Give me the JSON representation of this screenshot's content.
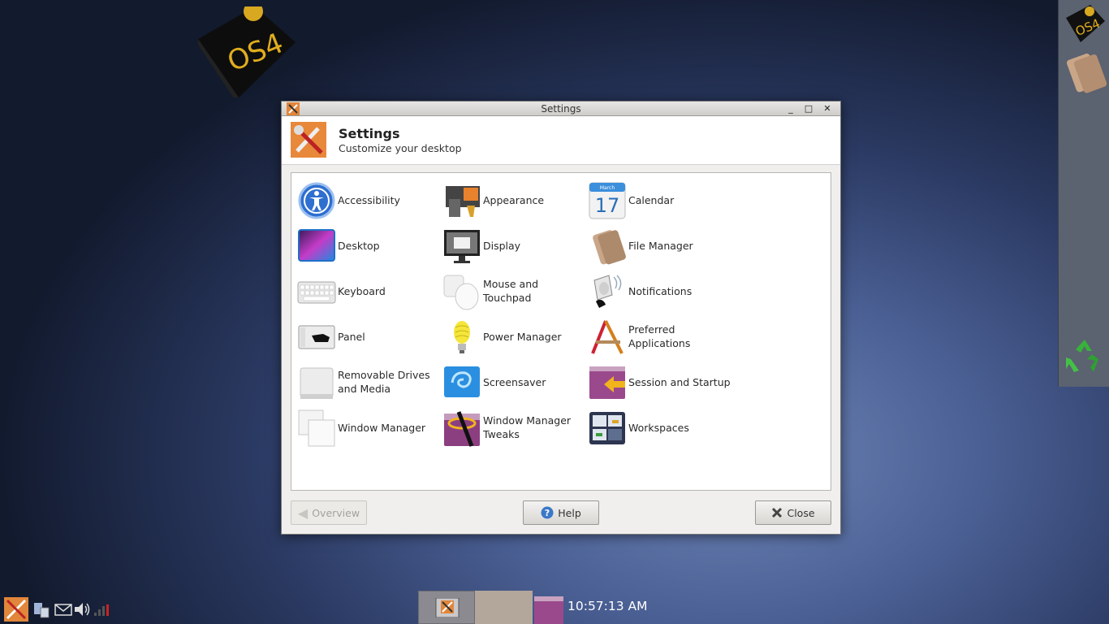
{
  "desktop": {
    "logo_text": "OS4"
  },
  "window": {
    "title": "Settings",
    "titlebar_buttons": {
      "minimize": "_",
      "maximize": "□",
      "close": "✕"
    },
    "header": {
      "title": "Settings",
      "subtitle": "Customize your desktop"
    },
    "items": [
      {
        "label": "Accessibility",
        "icon": "accessibility-icon"
      },
      {
        "label": "Appearance",
        "icon": "appearance-icon"
      },
      {
        "label": "Calendar",
        "icon": "calendar-icon",
        "icon_text": "17",
        "icon_month": "March"
      },
      {
        "label": "Desktop",
        "icon": "desktop-icon"
      },
      {
        "label": "Display",
        "icon": "display-icon"
      },
      {
        "label": "File Manager",
        "icon": "file-manager-icon"
      },
      {
        "label": "Keyboard",
        "icon": "keyboard-icon"
      },
      {
        "label": "Mouse and Touchpad",
        "icon": "mouse-icon"
      },
      {
        "label": "Notifications",
        "icon": "notifications-icon"
      },
      {
        "label": "Panel",
        "icon": "panel-icon"
      },
      {
        "label": "Power Manager",
        "icon": "power-manager-icon"
      },
      {
        "label": "Preferred Applications",
        "icon": "preferred-apps-icon"
      },
      {
        "label": "Removable Drives and Media",
        "icon": "removable-drive-icon"
      },
      {
        "label": "Screensaver",
        "icon": "screensaver-icon"
      },
      {
        "label": "Session and Startup",
        "icon": "session-icon"
      },
      {
        "label": "Window Manager",
        "icon": "window-manager-icon"
      },
      {
        "label": "Window Manager Tweaks",
        "icon": "wm-tweaks-icon"
      },
      {
        "label": "Workspaces",
        "icon": "workspaces-icon"
      }
    ],
    "buttons": {
      "overview": "Overview",
      "help": "Help",
      "close": "Close"
    }
  },
  "taskbar": {
    "clock": "10:57:13 AM"
  }
}
